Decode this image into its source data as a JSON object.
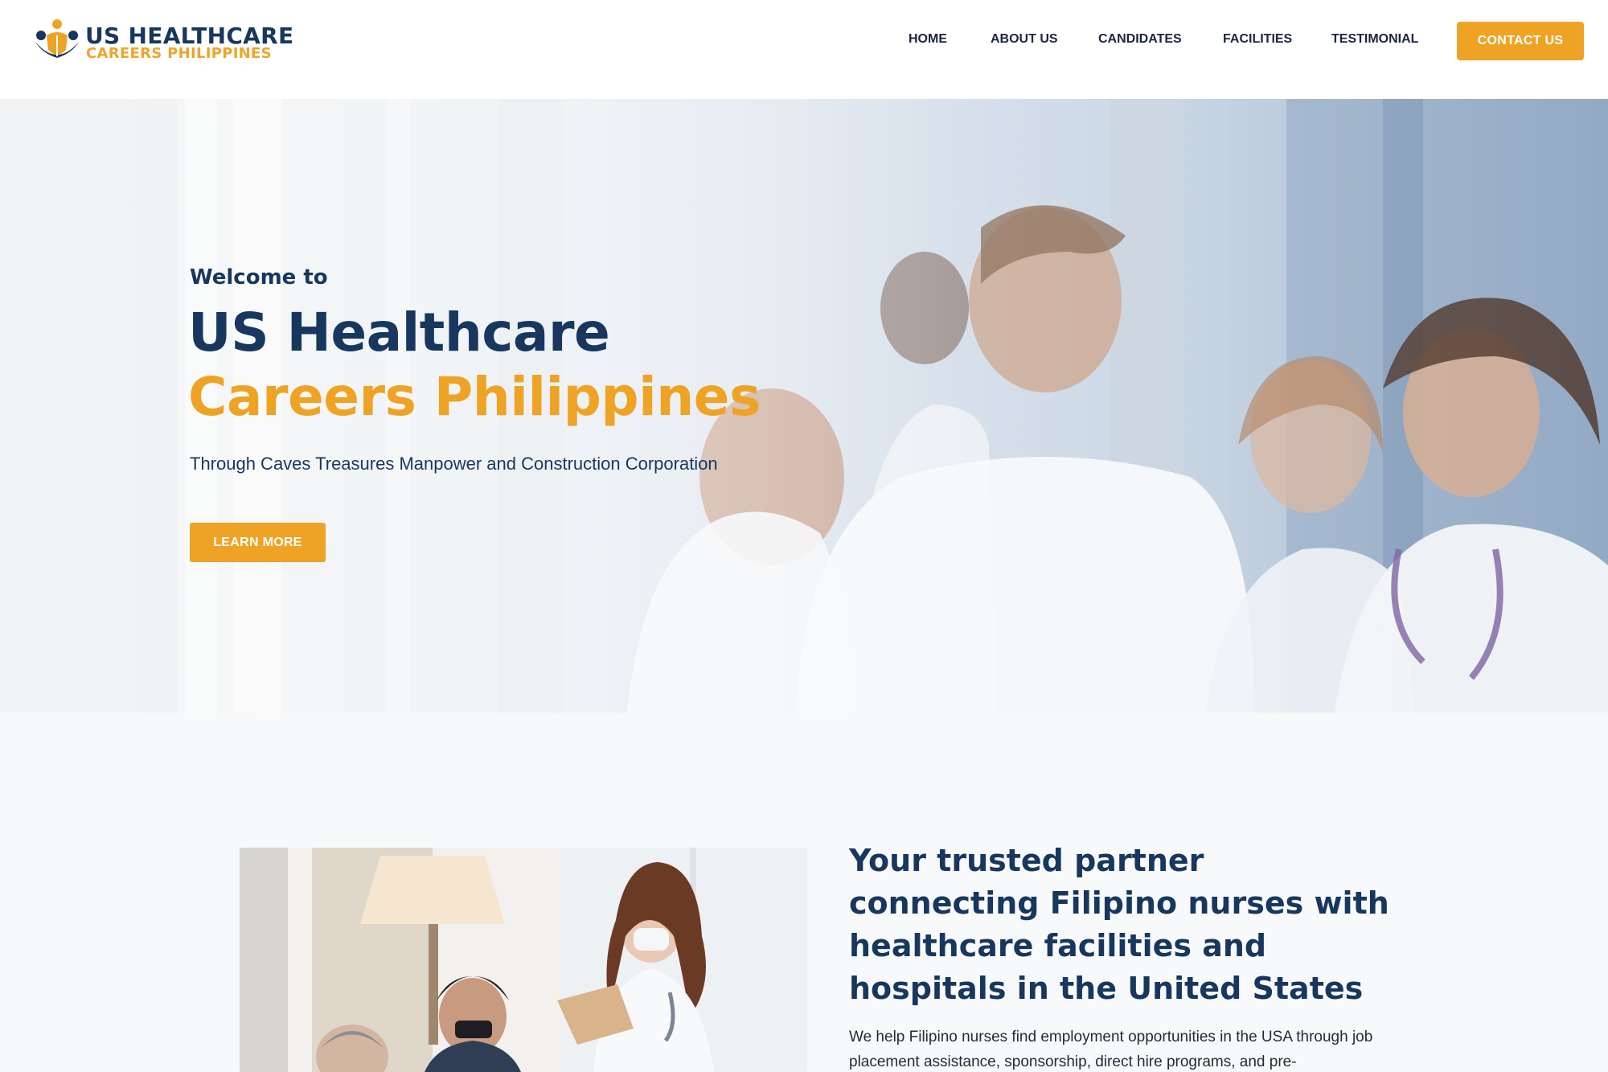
{
  "brand": {
    "line1": "US HEALTHCARE",
    "line2": "CAREERS PHILIPPINES",
    "colors": {
      "navy": "#17375e",
      "orange": "#eea325"
    }
  },
  "nav": {
    "home": "HOME",
    "about": "ABOUT US",
    "candidates": "CANDIDATES",
    "facilities": "FACILITIES",
    "testimonial": "TESTIMONIAL",
    "contact": "CONTACT US"
  },
  "hero": {
    "welcome": "Welcome to",
    "title_line1": "US Healthcare",
    "title_line2": "Careers Philippines",
    "subtitle": "Through Caves Treasures Manpower and Construction Corporation",
    "cta": "LEARN MORE"
  },
  "about": {
    "heading": "Your trusted partner connecting Filipino nurses with healthcare facilities and hospitals in the United States",
    "body": "We help Filipino nurses find employment opportunities in the USA through job placement assistance, sponsorship, direct hire programs, and pre-employment"
  }
}
